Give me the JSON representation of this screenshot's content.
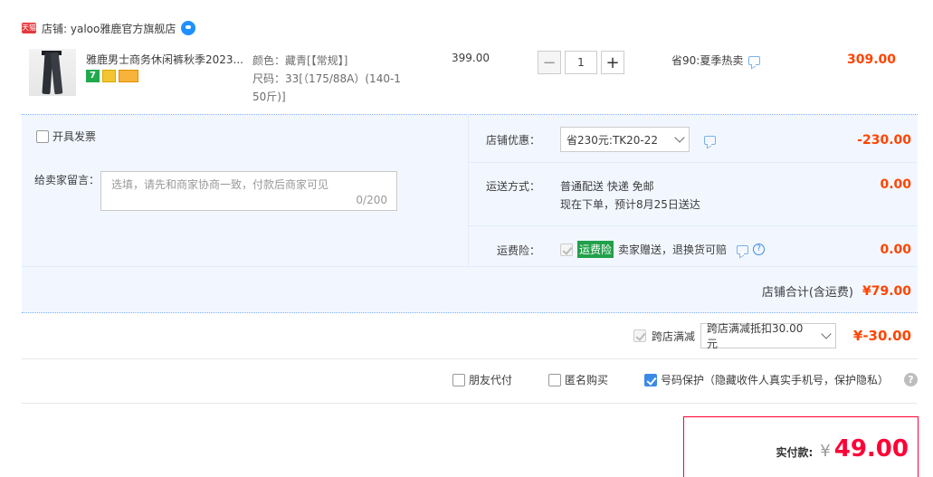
{
  "shop": {
    "label": "店铺: yaloo雅鹿官方旗舰店",
    "badge": "天猫"
  },
  "item": {
    "title": "雅鹿男士商务休闲裤秋季2023...",
    "sku_color": "颜色：藏青[【常规】]",
    "sku_size_1": "尺码：33[（175/88A）(140-1",
    "sku_size_2": "50斤)]",
    "unit_price": "399.00",
    "quantity": "1",
    "promo": "省90:夏季热卖",
    "total": "309.00",
    "badges": [
      "7",
      "",
      ""
    ]
  },
  "invoice": {
    "label": "开具发票"
  },
  "message": {
    "label": "给卖家留言：",
    "placeholder": "选填，请先和商家协商一致，付款后商家可见",
    "count": "0/200"
  },
  "discount": {
    "label": "店铺优惠：",
    "selected": "省230元:TK20-22",
    "amount": "-230.00"
  },
  "shipping": {
    "label": "运送方式：",
    "line1": "普通配送 快递 免邮",
    "line2": "现在下单，预计8月25日送达",
    "amount": "0.00"
  },
  "insurance": {
    "label": "运费险：",
    "tag": "运费险",
    "text": "卖家赠送，退换货可赔",
    "amount": "0.00"
  },
  "shop_total": {
    "label": "店铺合计(含运费)",
    "amount": "¥79.00"
  },
  "cross_store": {
    "label": "跨店满减",
    "selected": "跨店满减抵扣30.00元",
    "amount": "¥-30.00"
  },
  "options": {
    "friend_pay": "朋友代付",
    "anonymous": "匿名购买",
    "number_protect": "号码保护（隐藏收件人真实手机号，保护隐私）"
  },
  "payment": {
    "label": "实付款:",
    "currency": "¥",
    "amount": "49.00"
  },
  "colors": {
    "accent_red": "#ff4400",
    "pay_red": "#ff0036",
    "panel_bg": "#f2f7ff",
    "checkbox_blue": "#3c8ae6"
  }
}
